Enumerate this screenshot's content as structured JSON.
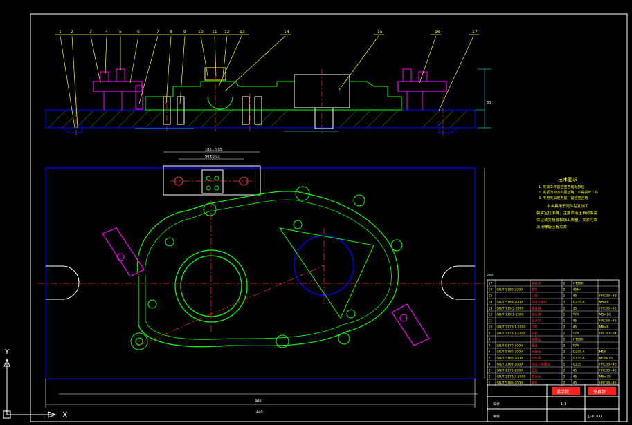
{
  "app": {
    "title": "AutoCAD drawing viewport",
    "background": "#000000"
  },
  "colors": {
    "outline": "#0000ff",
    "part": "#00ff00",
    "clamp": "#ff00ff",
    "center": "#ff0000",
    "text": "#ffff00",
    "dim": "#00c0c0",
    "frame": "#ffffff"
  },
  "balloons": [
    "1",
    "2",
    "3",
    "4",
    "5",
    "6",
    "7",
    "8",
    "9",
    "10",
    "11",
    "12",
    "13",
    "14",
    "15",
    "16",
    "17"
  ],
  "tech_notes": {
    "title": "技术要求",
    "lines": [
      "1. 夹紧工件前检查各装配部位",
      "2. 夹紧力和方向要正确，不得损坏工件",
      "3. 专用夹具使用前，需检查合格",
      "本夹具用于壳体钻孔加工",
      "装夹定位准确，主要靠液压自动夹紧",
      "保证装夹精度和加工质量，夹紧可靠",
      "采用螺旋压板夹紧"
    ]
  },
  "bom": {
    "rows": [
      {
        "no": "17",
        "std": "",
        "name": "夹具体",
        "qty": "1",
        "mat": "HT200",
        "note": ""
      },
      {
        "no": "16",
        "std": "GB/T 5780-2000",
        "name": "螺栓",
        "qty": "2",
        "mat": "45Mn",
        "note": ""
      },
      {
        "no": "15",
        "std": "",
        "name": "心轴",
        "qty": "1",
        "mat": "45",
        "note": "HRC38~43"
      },
      {
        "no": "14",
        "std": "GB/T 5783-2000",
        "name": "圆柱头螺钉",
        "qty": "2",
        "mat": "Q235-A",
        "note": "M5×8"
      },
      {
        "no": "13",
        "std": "GB/T 119.2-2000",
        "name": "圆柱销",
        "qty": "1",
        "mat": "35",
        "note": "HRC38~45"
      },
      {
        "no": "12",
        "std": "GB/T 119.1-2000",
        "name": "定位销",
        "qty": "2",
        "mat": "T7A",
        "note": "M5×16"
      },
      {
        "no": "11",
        "std": "",
        "name": "支承钉",
        "qty": "1",
        "mat": "45",
        "note": "HRC38~45"
      },
      {
        "no": "10",
        "std": "GB/T 2179.1-2000",
        "name": "衬套",
        "qty": "2",
        "mat": "45",
        "note": "M6×8"
      },
      {
        "no": "9",
        "std": "GB/T 2179.1-2000",
        "name": "钻套",
        "qty": "2",
        "mat": "T7A",
        "note": "HRC60~64"
      },
      {
        "no": "8",
        "std": "",
        "name": "钻模板",
        "qty": "1",
        "mat": "HT200",
        "note": ""
      },
      {
        "no": "7",
        "std": "GB/T 6170-2000",
        "name": "螺母",
        "qty": "2",
        "mat": "T7A",
        "note": ""
      },
      {
        "no": "6",
        "std": "GB/T 5780-2000",
        "name": "大螺母",
        "qty": "2",
        "mat": "Q235-A",
        "note": "M10"
      },
      {
        "no": "5",
        "std": "GB/T 5780-2000",
        "name": "大垫圈",
        "qty": "2",
        "mat": "Q235-A",
        "note": "M10×75"
      },
      {
        "no": "4",
        "std": "GB/T 2163-2000",
        "name": "带肩六角螺母",
        "qty": "2",
        "mat": "Q235",
        "note": "HRC38~45"
      },
      {
        "no": "3",
        "std": "GB/T 2175-2000",
        "name": "压板",
        "qty": "2",
        "mat": "45",
        "note": "HRC38~45"
      },
      {
        "no": "2",
        "std": "GB/T 2178.3-2000",
        "name": "支承板",
        "qty": "2",
        "mat": "45",
        "note": "M6×35"
      },
      {
        "no": "1",
        "std": "GB/T 5786-2000",
        "name": "螺栓",
        "qty": "2",
        "mat": "45",
        "note": "HRC38~45"
      }
    ]
  },
  "title_block": {
    "school": "某学院",
    "name": "夹具体",
    "drawing_no": "JJ-01-00",
    "scale": "1:1",
    "checked": "审核",
    "designed": "设计"
  },
  "dims": {
    "top_width": "100±0.05",
    "top_inner": "94±0.03",
    "overall": "400",
    "bottom_total": "440",
    "height": "80",
    "side": "250"
  },
  "ucs": {
    "x_label": "X",
    "y_label": "Y"
  }
}
